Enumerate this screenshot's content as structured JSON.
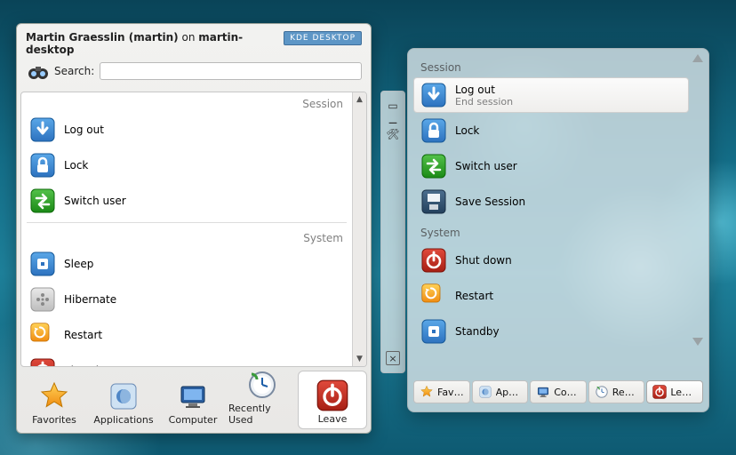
{
  "panel1": {
    "user_full": "Martin Graesslin (martin)",
    "user_on": "on",
    "host": "martin-desktop",
    "kde_badge": "KDE DESKTOP",
    "search_label": "Search:",
    "search_value": "",
    "groups": [
      {
        "title": "Session",
        "items": [
          {
            "id": "logout",
            "label": "Log out",
            "icon": "logout-icon"
          },
          {
            "id": "lock",
            "label": "Lock",
            "icon": "lock-icon"
          },
          {
            "id": "switch",
            "label": "Switch user",
            "icon": "switch-user-icon"
          }
        ]
      },
      {
        "title": "System",
        "items": [
          {
            "id": "sleep",
            "label": "Sleep",
            "icon": "sleep-icon"
          },
          {
            "id": "hibernate",
            "label": "Hibernate",
            "icon": "hibernate-icon"
          },
          {
            "id": "restart",
            "label": "Restart",
            "icon": "restart-icon"
          },
          {
            "id": "shutdown",
            "label": "Shut down",
            "icon": "power-icon"
          }
        ]
      }
    ],
    "tabs": [
      {
        "id": "favorites",
        "label": "Favorites",
        "icon": "star-icon"
      },
      {
        "id": "applications",
        "label": "Applications",
        "icon": "apps-icon"
      },
      {
        "id": "computer",
        "label": "Computer",
        "icon": "monitor-icon"
      },
      {
        "id": "recent",
        "label": "Recently Used",
        "icon": "clock-icon"
      },
      {
        "id": "leave",
        "label": "Leave",
        "icon": "power-icon",
        "active": true
      }
    ]
  },
  "midstrip": {
    "tools": [
      "screen-icon",
      "zoom-out-icon",
      "wrench-icon"
    ],
    "close": "×"
  },
  "panel2": {
    "groups": [
      {
        "title": "Session",
        "items": [
          {
            "id": "logout",
            "label": "Log out",
            "sub": "End session",
            "icon": "logout-icon",
            "selected": true
          },
          {
            "id": "lock",
            "label": "Lock",
            "icon": "lock-icon"
          },
          {
            "id": "switch",
            "label": "Switch user",
            "icon": "switch-user-icon"
          },
          {
            "id": "save",
            "label": "Save Session",
            "icon": "save-icon"
          }
        ]
      },
      {
        "title": "System",
        "items": [
          {
            "id": "shutdown",
            "label": "Shut down",
            "icon": "power-icon"
          },
          {
            "id": "restart",
            "label": "Restart",
            "icon": "restart-icon"
          },
          {
            "id": "standby",
            "label": "Standby",
            "icon": "sleep-icon"
          }
        ]
      }
    ],
    "tabs": [
      {
        "id": "favorites",
        "label": "Favor…",
        "icon": "star-icon"
      },
      {
        "id": "applications",
        "label": "Appli…",
        "icon": "apps-icon"
      },
      {
        "id": "computer",
        "label": "Comp…",
        "icon": "monitor-icon"
      },
      {
        "id": "recent",
        "label": "Rece…",
        "icon": "clock-icon"
      },
      {
        "id": "leave",
        "label": "Leave",
        "icon": "power-icon",
        "active": true
      }
    ]
  }
}
